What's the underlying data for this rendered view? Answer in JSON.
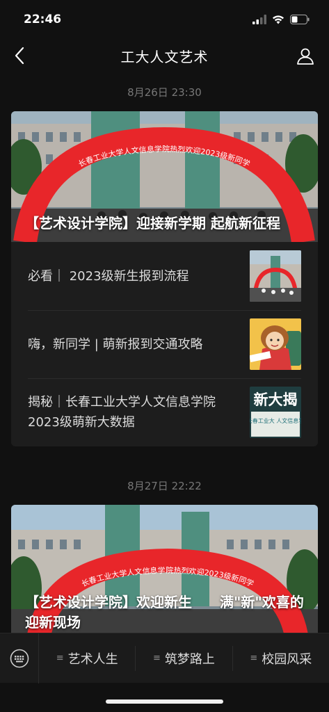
{
  "status_bar": {
    "time": "22:46"
  },
  "nav": {
    "title": "工大人文艺术"
  },
  "groups": [
    {
      "timestamp": "8月26日 23:30",
      "lead_title": "【艺术设计学院】迎接新学期 起航新征程",
      "arch_text": "长春工业大学人文信息学院热烈欢迎2023级新同学",
      "items": [
        {
          "title": "必看｜ 2023级新生报到流程"
        },
        {
          "title": "嗨，新同学 | 萌新报到交通攻略"
        },
        {
          "title": "揭秘｜长春工业大学人文信息学院2023级萌新大数据",
          "thumb_text": "新大揭",
          "thumb_subtext": "长春工业大 人文信息学"
        }
      ]
    },
    {
      "timestamp": "8月27日 22:22",
      "lead_title": "【艺术设计学院】欢迎新生　　满\"新\"欢喜的迎新现场",
      "arch_text": "长春工业大学人文信息学院热烈欢迎2023级新同学"
    }
  ],
  "tab_bar": {
    "menus": [
      {
        "label": "艺术人生"
      },
      {
        "label": "筑梦路上"
      },
      {
        "label": "校园风采"
      }
    ]
  },
  "colors": {
    "background": "#111111",
    "card": "#1d1d1d",
    "arch": "#e8262a",
    "timestamp": "#777777"
  }
}
